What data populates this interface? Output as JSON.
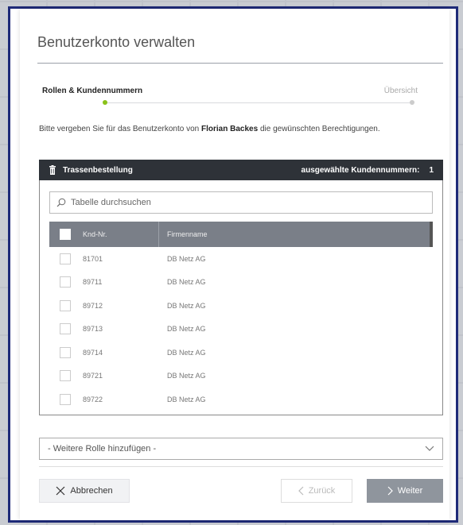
{
  "dialog": {
    "title": "Benutzerkonto verwalten"
  },
  "steps": {
    "active": "Rollen & Kundennummern",
    "next": "Übersicht"
  },
  "intro": {
    "prefix": "Bitte vergeben Sie für das Benutzerkonto von ",
    "user": "Florian Backes",
    "suffix": " die gewünschten Berechtigungen."
  },
  "panel": {
    "title": "Trassenbestellung",
    "selected_label": "ausgewählte Kundennummern:",
    "selected_count": "1",
    "search_placeholder": "Tabelle durchsuchen",
    "columns": [
      "Knd-Nr.",
      "Firmenname"
    ],
    "rows": [
      {
        "knd": "81701",
        "name": "DB Netz AG"
      },
      {
        "knd": "89711",
        "name": "DB Netz AG"
      },
      {
        "knd": "89712",
        "name": "DB Netz AG"
      },
      {
        "knd": "89713",
        "name": "DB Netz AG"
      },
      {
        "knd": "89714",
        "name": "DB Netz AG"
      },
      {
        "knd": "89721",
        "name": "DB Netz AG"
      },
      {
        "knd": "89722",
        "name": "DB Netz AG"
      }
    ]
  },
  "role_select": {
    "value": "- Weitere Rolle hinzufügen -"
  },
  "buttons": {
    "cancel": "Abbrechen",
    "back": "Zurück",
    "next": "Weiter"
  },
  "colors": {
    "accent_dot": "#8ac21a",
    "frame": "#1e2a78",
    "panel_header": "#2e3238"
  }
}
